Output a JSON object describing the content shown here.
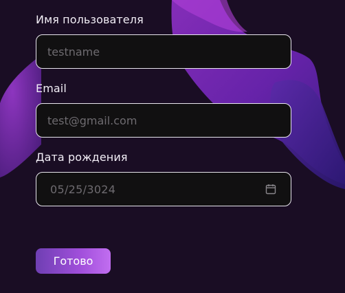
{
  "form": {
    "username": {
      "label": "Имя пользователя",
      "placeholder": "testname"
    },
    "email": {
      "label": "Email",
      "placeholder": "test@gmail.com"
    },
    "birthdate": {
      "label": "Дата рождения",
      "month": "05",
      "day": "25",
      "year": "3024",
      "icon": "calendar-icon"
    },
    "submit_label": "Готово"
  },
  "colors": {
    "background": "#1a0d24",
    "accent_start": "#6f3fb3",
    "accent_end": "#c16ef0",
    "input_border": "#e9e6ee",
    "input_bg": "#111011"
  }
}
